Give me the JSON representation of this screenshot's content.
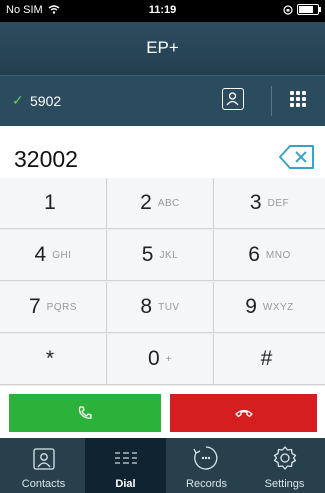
{
  "status": {
    "carrier": "No SIM",
    "time": "11:19"
  },
  "nav": {
    "title": "EP+"
  },
  "line": {
    "number": "5902"
  },
  "dial": {
    "number": "32002"
  },
  "keys": [
    {
      "digit": "1",
      "letters": ""
    },
    {
      "digit": "2",
      "letters": "ABC"
    },
    {
      "digit": "3",
      "letters": "DEF"
    },
    {
      "digit": "4",
      "letters": "GHI"
    },
    {
      "digit": "5",
      "letters": "JKL"
    },
    {
      "digit": "6",
      "letters": "MNO"
    },
    {
      "digit": "7",
      "letters": "PQRS"
    },
    {
      "digit": "8",
      "letters": "TUV"
    },
    {
      "digit": "9",
      "letters": "WXYZ"
    },
    {
      "digit": "*",
      "letters": ""
    },
    {
      "digit": "0",
      "letters": "+"
    },
    {
      "digit": "#",
      "letters": ""
    }
  ],
  "tabs": [
    {
      "label": "Contacts",
      "icon": "contacts-icon"
    },
    {
      "label": "Dial",
      "icon": "dialpad-icon"
    },
    {
      "label": "Records",
      "icon": "records-icon"
    },
    {
      "label": "Settings",
      "icon": "settings-icon"
    }
  ],
  "colors": {
    "call": "#2bb23a",
    "hangup": "#d51e1f",
    "header": "#2b4b5e"
  }
}
